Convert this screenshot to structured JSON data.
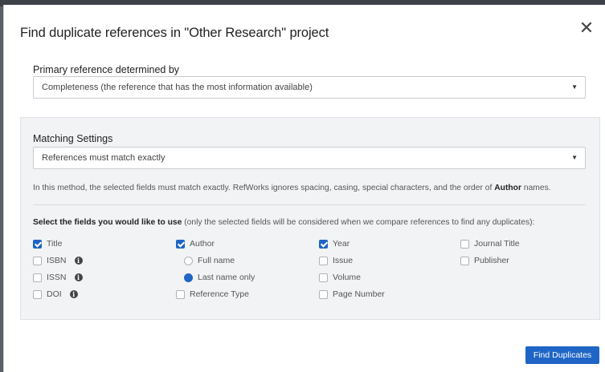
{
  "dialog": {
    "title": "Find duplicate references in \"Other Research\" project",
    "close_symbol": "✕"
  },
  "primary": {
    "label": "Primary reference determined by",
    "selected": "Completeness (the reference that has the most information available)"
  },
  "matching": {
    "label": "Matching Settings",
    "selected": "References must match exactly",
    "description_prefix": "In this method, the selected fields must match exactly. RefWorks ignores spacing, casing, special characters, and the order of ",
    "description_bold": "Author",
    "description_suffix": " names."
  },
  "fields": {
    "intro_bold": "Select the fields you would like to use",
    "intro_rest": " (only the selected fields will be considered when we compare references to find any duplicates):",
    "title": {
      "label": "Title",
      "checked": true
    },
    "isbn": {
      "label": "ISBN",
      "checked": false
    },
    "issn": {
      "label": "ISSN",
      "checked": false
    },
    "doi": {
      "label": "DOI",
      "checked": false
    },
    "author": {
      "label": "Author",
      "checked": true
    },
    "full_name": {
      "label": "Full name",
      "selected": false
    },
    "last_name_only": {
      "label": "Last name only",
      "selected": true
    },
    "reference_type": {
      "label": "Reference Type",
      "checked": false
    },
    "year": {
      "label": "Year",
      "checked": true
    },
    "issue": {
      "label": "Issue",
      "checked": false
    },
    "volume": {
      "label": "Volume",
      "checked": false
    },
    "page_number": {
      "label": "Page Number",
      "checked": false
    },
    "journal_title": {
      "label": "Journal Title",
      "checked": false
    },
    "publisher": {
      "label": "Publisher",
      "checked": false
    }
  },
  "info_icon_glyph": "i",
  "dropdown_caret": "▼",
  "footer": {
    "find_label": "Find Duplicates"
  },
  "colors": {
    "accent": "#1f65c6",
    "panel_bg": "#f2f3f4"
  }
}
